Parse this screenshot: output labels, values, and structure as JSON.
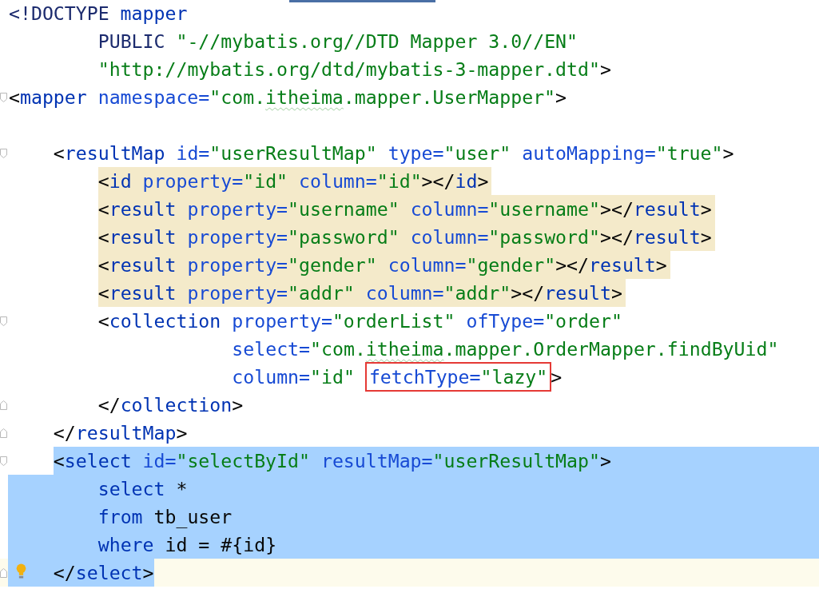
{
  "editor": {
    "lines": [
      {
        "kind": "code",
        "fold_start": false,
        "fold_end": false,
        "matched": false,
        "selected": false,
        "tokens": [
          {
            "kind": "doctype",
            "text": "<!DOCTYPE"
          },
          {
            "kind": "tag",
            "text": " mapper"
          }
        ],
        "children": [
          {
            "kind": "continuation",
            "fold_start": false,
            "fold_end": false,
            "matched": false,
            "selected": false,
            "tokens": [
              {
                "kind": "doctype",
                "text": "PUBLIC"
              },
              {
                "kind": "value",
                "text": " \"-//mybatis.org//DTD Mapper 3.0//EN\""
              }
            ]
          },
          {
            "kind": "continuation",
            "fold_start": false,
            "fold_end": false,
            "matched": false,
            "selected": false,
            "tokens": [
              {
                "kind": "value",
                "text": "\"http://mybatis.org/dtd/mybatis-3-mapper.dtd\""
              },
              {
                "kind": "punct",
                "text": ">"
              }
            ]
          }
        ]
      },
      {
        "kind": "code",
        "fold_start": true,
        "fold_end": false,
        "matched": false,
        "selected": false,
        "tokens": [
          {
            "kind": "punct",
            "text": "<"
          },
          {
            "kind": "tag",
            "text": "mapper"
          },
          {
            "kind": "attr",
            "text": " namespace="
          },
          {
            "kind": "value",
            "text": "\"com."
          },
          {
            "kind": "value",
            "text": "itheima",
            "typo": true
          },
          {
            "kind": "value",
            "text": ".mapper.UserMapper\""
          },
          {
            "kind": "punct",
            "text": ">"
          }
        ],
        "children": [
          {
            "kind": "blank",
            "fold_start": false,
            "fold_end": false,
            "matched": false,
            "selected": false
          },
          {
            "kind": "code",
            "fold_start": true,
            "fold_end": false,
            "matched": false,
            "selected": false,
            "tokens": [
              {
                "kind": "punct",
                "text": "<"
              },
              {
                "kind": "tag",
                "text": "resultMap"
              },
              {
                "kind": "attr",
                "text": " id="
              },
              {
                "kind": "value",
                "text": "\"userResultMap\""
              },
              {
                "kind": "attr",
                "text": " type="
              },
              {
                "kind": "value",
                "text": "\"user\""
              },
              {
                "kind": "attr",
                "text": " autoMapping="
              },
              {
                "kind": "value",
                "text": "\"true\""
              },
              {
                "kind": "punct",
                "text": ">"
              }
            ],
            "children": [
              {
                "kind": "code",
                "fold_start": false,
                "fold_end": false,
                "matched": true,
                "selected": false,
                "tokens": [
                  {
                    "kind": "punct",
                    "text": "<"
                  },
                  {
                    "kind": "tag",
                    "text": "id"
                  },
                  {
                    "kind": "attr",
                    "text": " property="
                  },
                  {
                    "kind": "value",
                    "text": "\"id\""
                  },
                  {
                    "kind": "attr",
                    "text": " column="
                  },
                  {
                    "kind": "value",
                    "text": "\"id\""
                  },
                  {
                    "kind": "punct",
                    "text": "></"
                  },
                  {
                    "kind": "tag",
                    "text": "id"
                  },
                  {
                    "kind": "punct",
                    "text": ">"
                  }
                ]
              },
              {
                "kind": "code",
                "fold_start": false,
                "fold_end": false,
                "matched": true,
                "selected": false,
                "tokens": [
                  {
                    "kind": "punct",
                    "text": "<"
                  },
                  {
                    "kind": "tag",
                    "text": "result"
                  },
                  {
                    "kind": "attr",
                    "text": " property="
                  },
                  {
                    "kind": "value",
                    "text": "\"username\""
                  },
                  {
                    "kind": "attr",
                    "text": " column="
                  },
                  {
                    "kind": "value",
                    "text": "\"username\""
                  },
                  {
                    "kind": "punct",
                    "text": "></"
                  },
                  {
                    "kind": "tag",
                    "text": "result"
                  },
                  {
                    "kind": "punct",
                    "text": ">"
                  }
                ]
              },
              {
                "kind": "code",
                "fold_start": false,
                "fold_end": false,
                "matched": true,
                "selected": false,
                "tokens": [
                  {
                    "kind": "punct",
                    "text": "<"
                  },
                  {
                    "kind": "tag",
                    "text": "result"
                  },
                  {
                    "kind": "attr",
                    "text": " property="
                  },
                  {
                    "kind": "value",
                    "text": "\"password\""
                  },
                  {
                    "kind": "attr",
                    "text": " column="
                  },
                  {
                    "kind": "value",
                    "text": "\"password\""
                  },
                  {
                    "kind": "punct",
                    "text": "></"
                  },
                  {
                    "kind": "tag",
                    "text": "result"
                  },
                  {
                    "kind": "punct",
                    "text": ">"
                  }
                ]
              },
              {
                "kind": "code",
                "fold_start": false,
                "fold_end": false,
                "matched": true,
                "selected": false,
                "tokens": [
                  {
                    "kind": "punct",
                    "text": "<"
                  },
                  {
                    "kind": "tag",
                    "text": "result"
                  },
                  {
                    "kind": "attr",
                    "text": " property="
                  },
                  {
                    "kind": "value",
                    "text": "\"gender\""
                  },
                  {
                    "kind": "attr",
                    "text": " column="
                  },
                  {
                    "kind": "value",
                    "text": "\"gender\""
                  },
                  {
                    "kind": "punct",
                    "text": "></"
                  },
                  {
                    "kind": "tag",
                    "text": "result"
                  },
                  {
                    "kind": "punct",
                    "text": ">"
                  }
                ]
              },
              {
                "kind": "code",
                "fold_start": false,
                "fold_end": false,
                "matched": true,
                "selected": false,
                "tokens": [
                  {
                    "kind": "punct",
                    "text": "<"
                  },
                  {
                    "kind": "tag",
                    "text": "result"
                  },
                  {
                    "kind": "attr",
                    "text": " property="
                  },
                  {
                    "kind": "value",
                    "text": "\"addr\""
                  },
                  {
                    "kind": "attr",
                    "text": " column="
                  },
                  {
                    "kind": "value",
                    "text": "\"addr\""
                  },
                  {
                    "kind": "punct",
                    "text": "></"
                  },
                  {
                    "kind": "tag",
                    "text": "result"
                  },
                  {
                    "kind": "punct",
                    "text": ">"
                  }
                ]
              },
              {
                "kind": "code",
                "fold_start": true,
                "fold_end": false,
                "matched": false,
                "selected": false,
                "tokens": [
                  {
                    "kind": "punct",
                    "text": "<"
                  },
                  {
                    "kind": "tag",
                    "text": "collection"
                  },
                  {
                    "kind": "attr",
                    "text": " property="
                  },
                  {
                    "kind": "value",
                    "text": "\"orderList\""
                  },
                  {
                    "kind": "attr",
                    "text": " ofType="
                  },
                  {
                    "kind": "value",
                    "text": "\"order\""
                  }
                ],
                "children": [
                  {
                    "kind": "aligned",
                    "fold_start": false,
                    "fold_end": false,
                    "matched": false,
                    "selected": false,
                    "tokens": [
                      {
                        "kind": "attr",
                        "text": "select="
                      },
                      {
                        "kind": "value",
                        "text": "\"com."
                      },
                      {
                        "kind": "value",
                        "text": "itheima",
                        "typo": true
                      },
                      {
                        "kind": "value",
                        "text": ".mapper.OrderMapper.findByUid\""
                      }
                    ]
                  },
                  {
                    "kind": "aligned",
                    "fold_start": false,
                    "fold_end": false,
                    "matched": false,
                    "selected": false,
                    "tokens": [
                      {
                        "kind": "attr",
                        "text": "column="
                      },
                      {
                        "kind": "value",
                        "text": "\"id\""
                      },
                      {
                        "kind": "attr",
                        "text": "fetchType=",
                        "outlined": true
                      },
                      {
                        "kind": "value",
                        "text": "\"lazy\"",
                        "outlined": true
                      },
                      {
                        "kind": "punct",
                        "text": ">"
                      }
                    ]
                  }
                ]
              },
              {
                "kind": "code",
                "fold_start": false,
                "fold_end": true,
                "matched": false,
                "selected": false,
                "tokens": [
                  {
                    "kind": "punct",
                    "text": "</"
                  },
                  {
                    "kind": "tag",
                    "text": "collection"
                  },
                  {
                    "kind": "punct",
                    "text": ">"
                  }
                ]
              }
            ]
          },
          {
            "kind": "code",
            "fold_start": false,
            "fold_end": true,
            "matched": false,
            "selected": false,
            "tokens": [
              {
                "kind": "punct",
                "text": "</"
              },
              {
                "kind": "tag",
                "text": "resultMap"
              },
              {
                "kind": "punct",
                "text": ">"
              }
            ]
          },
          {
            "kind": "code",
            "fold_start": true,
            "fold_end": false,
            "matched": false,
            "selected": true,
            "tokens": [
              {
                "kind": "punct",
                "text": "<"
              },
              {
                "kind": "tag",
                "text": "select"
              },
              {
                "kind": "attr",
                "text": " id="
              },
              {
                "kind": "value",
                "text": "\"selectById\""
              },
              {
                "kind": "attr",
                "text": " resultMap="
              },
              {
                "kind": "value",
                "text": "\"userResultMap\""
              },
              {
                "kind": "punct",
                "text": ">"
              }
            ],
            "children": [
              {
                "kind": "code",
                "fold_start": false,
                "fold_end": false,
                "matched": false,
                "selected": true,
                "tokens": [
                  {
                    "kind": "keyword",
                    "text": "select"
                  },
                  {
                    "kind": "plain",
                    "text": " *"
                  }
                ]
              },
              {
                "kind": "code",
                "fold_start": false,
                "fold_end": false,
                "matched": false,
                "selected": true,
                "tokens": [
                  {
                    "kind": "keyword",
                    "text": "from"
                  },
                  {
                    "kind": "plain",
                    "text": " tb_user"
                  }
                ]
              },
              {
                "kind": "code",
                "fold_start": false,
                "fold_end": false,
                "matched": false,
                "selected": true,
                "tokens": [
                  {
                    "kind": "keyword",
                    "text": "where"
                  },
                  {
                    "kind": "plain",
                    "text": " id = #{id}"
                  }
                ]
              }
            ]
          },
          {
            "kind": "code",
            "fold_start": false,
            "fold_end": true,
            "matched": false,
            "selected": true,
            "current": true,
            "bulb": true,
            "tokens": [
              {
                "kind": "punct",
                "text": "</"
              },
              {
                "kind": "tag",
                "text": "select"
              },
              {
                "kind": "punct",
                "text": ">"
              }
            ]
          }
        ]
      }
    ]
  }
}
